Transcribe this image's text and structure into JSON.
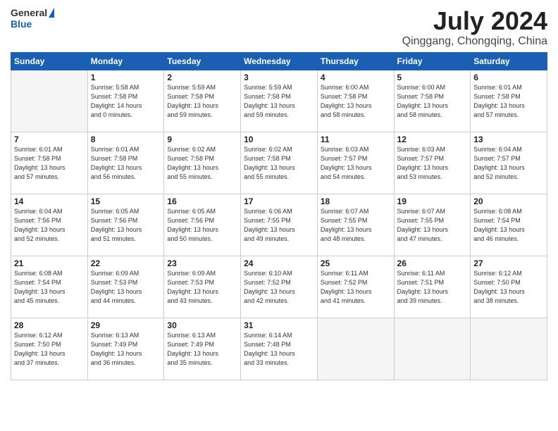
{
  "header": {
    "logo_general": "General",
    "logo_blue": "Blue",
    "title": "July 2024",
    "location": "Qinggang, Chongqing, China"
  },
  "calendar": {
    "days_of_week": [
      "Sunday",
      "Monday",
      "Tuesday",
      "Wednesday",
      "Thursday",
      "Friday",
      "Saturday"
    ],
    "weeks": [
      [
        {
          "day": "",
          "info": ""
        },
        {
          "day": "1",
          "info": "Sunrise: 5:58 AM\nSunset: 7:58 PM\nDaylight: 14 hours\nand 0 minutes."
        },
        {
          "day": "2",
          "info": "Sunrise: 5:59 AM\nSunset: 7:58 PM\nDaylight: 13 hours\nand 59 minutes."
        },
        {
          "day": "3",
          "info": "Sunrise: 5:59 AM\nSunset: 7:58 PM\nDaylight: 13 hours\nand 59 minutes."
        },
        {
          "day": "4",
          "info": "Sunrise: 6:00 AM\nSunset: 7:58 PM\nDaylight: 13 hours\nand 58 minutes."
        },
        {
          "day": "5",
          "info": "Sunrise: 6:00 AM\nSunset: 7:58 PM\nDaylight: 13 hours\nand 58 minutes."
        },
        {
          "day": "6",
          "info": "Sunrise: 6:01 AM\nSunset: 7:58 PM\nDaylight: 13 hours\nand 57 minutes."
        }
      ],
      [
        {
          "day": "7",
          "info": "Sunrise: 6:01 AM\nSunset: 7:58 PM\nDaylight: 13 hours\nand 57 minutes."
        },
        {
          "day": "8",
          "info": "Sunrise: 6:01 AM\nSunset: 7:58 PM\nDaylight: 13 hours\nand 56 minutes."
        },
        {
          "day": "9",
          "info": "Sunrise: 6:02 AM\nSunset: 7:58 PM\nDaylight: 13 hours\nand 55 minutes."
        },
        {
          "day": "10",
          "info": "Sunrise: 6:02 AM\nSunset: 7:58 PM\nDaylight: 13 hours\nand 55 minutes."
        },
        {
          "day": "11",
          "info": "Sunrise: 6:03 AM\nSunset: 7:57 PM\nDaylight: 13 hours\nand 54 minutes."
        },
        {
          "day": "12",
          "info": "Sunrise: 6:03 AM\nSunset: 7:57 PM\nDaylight: 13 hours\nand 53 minutes."
        },
        {
          "day": "13",
          "info": "Sunrise: 6:04 AM\nSunset: 7:57 PM\nDaylight: 13 hours\nand 52 minutes."
        }
      ],
      [
        {
          "day": "14",
          "info": "Sunrise: 6:04 AM\nSunset: 7:56 PM\nDaylight: 13 hours\nand 52 minutes."
        },
        {
          "day": "15",
          "info": "Sunrise: 6:05 AM\nSunset: 7:56 PM\nDaylight: 13 hours\nand 51 minutes."
        },
        {
          "day": "16",
          "info": "Sunrise: 6:05 AM\nSunset: 7:56 PM\nDaylight: 13 hours\nand 50 minutes."
        },
        {
          "day": "17",
          "info": "Sunrise: 6:06 AM\nSunset: 7:55 PM\nDaylight: 13 hours\nand 49 minutes."
        },
        {
          "day": "18",
          "info": "Sunrise: 6:07 AM\nSunset: 7:55 PM\nDaylight: 13 hours\nand 48 minutes."
        },
        {
          "day": "19",
          "info": "Sunrise: 6:07 AM\nSunset: 7:55 PM\nDaylight: 13 hours\nand 47 minutes."
        },
        {
          "day": "20",
          "info": "Sunrise: 6:08 AM\nSunset: 7:54 PM\nDaylight: 13 hours\nand 46 minutes."
        }
      ],
      [
        {
          "day": "21",
          "info": "Sunrise: 6:08 AM\nSunset: 7:54 PM\nDaylight: 13 hours\nand 45 minutes."
        },
        {
          "day": "22",
          "info": "Sunrise: 6:09 AM\nSunset: 7:53 PM\nDaylight: 13 hours\nand 44 minutes."
        },
        {
          "day": "23",
          "info": "Sunrise: 6:09 AM\nSunset: 7:53 PM\nDaylight: 13 hours\nand 43 minutes."
        },
        {
          "day": "24",
          "info": "Sunrise: 6:10 AM\nSunset: 7:52 PM\nDaylight: 13 hours\nand 42 minutes."
        },
        {
          "day": "25",
          "info": "Sunrise: 6:11 AM\nSunset: 7:52 PM\nDaylight: 13 hours\nand 41 minutes."
        },
        {
          "day": "26",
          "info": "Sunrise: 6:11 AM\nSunset: 7:51 PM\nDaylight: 13 hours\nand 39 minutes."
        },
        {
          "day": "27",
          "info": "Sunrise: 6:12 AM\nSunset: 7:50 PM\nDaylight: 13 hours\nand 38 minutes."
        }
      ],
      [
        {
          "day": "28",
          "info": "Sunrise: 6:12 AM\nSunset: 7:50 PM\nDaylight: 13 hours\nand 37 minutes."
        },
        {
          "day": "29",
          "info": "Sunrise: 6:13 AM\nSunset: 7:49 PM\nDaylight: 13 hours\nand 36 minutes."
        },
        {
          "day": "30",
          "info": "Sunrise: 6:13 AM\nSunset: 7:49 PM\nDaylight: 13 hours\nand 35 minutes."
        },
        {
          "day": "31",
          "info": "Sunrise: 6:14 AM\nSunset: 7:48 PM\nDaylight: 13 hours\nand 33 minutes."
        },
        {
          "day": "",
          "info": ""
        },
        {
          "day": "",
          "info": ""
        },
        {
          "day": "",
          "info": ""
        }
      ]
    ]
  }
}
